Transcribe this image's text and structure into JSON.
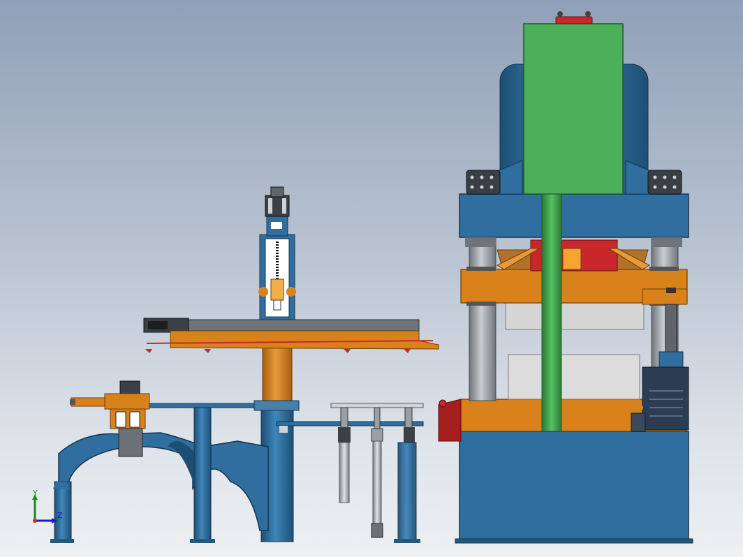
{
  "viewport": {
    "background_top": "#8fa0b8",
    "background_bottom": "#eef0f2"
  },
  "triad": {
    "y_label": "Y",
    "z_label": "Z"
  },
  "colors": {
    "frame_blue": "#2f6e9e",
    "frame_blue_dark": "#1d4f75",
    "orange": "#d9821c",
    "cylinder_green": "#4caf5a",
    "rod_green": "#3a9a45",
    "red": "#c23a2e",
    "steel_gray": "#9aa0a6",
    "motor_dark": "#2b3d52"
  },
  "parts": [
    "press-frame",
    "hydraulic-cylinder",
    "gantry-manipulator",
    "turntable-arm",
    "ejector-rods",
    "motor-pump-unit"
  ]
}
